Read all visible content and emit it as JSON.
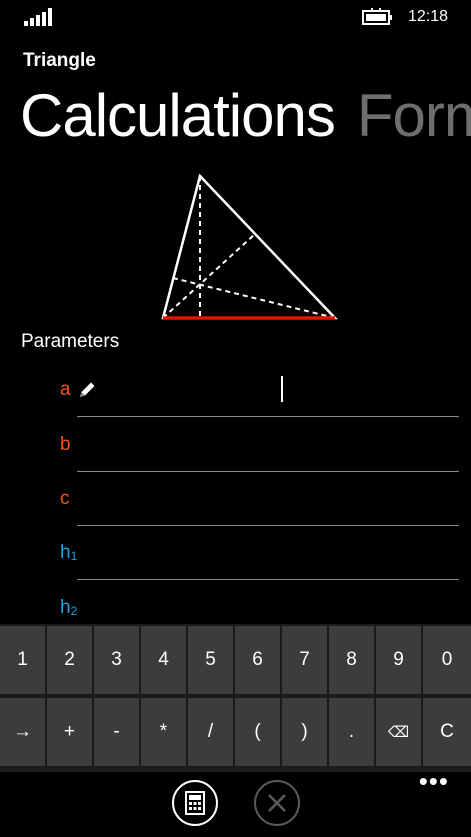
{
  "status": {
    "time": "12:18"
  },
  "app": {
    "title": "Triangle"
  },
  "pivot": {
    "active": "Calculations",
    "next": "Form"
  },
  "section": {
    "label": "Parameters"
  },
  "params": [
    {
      "label": "a",
      "sub": "",
      "color": "#f0541e",
      "value": ""
    },
    {
      "label": "b",
      "sub": "",
      "color": "#f0541e",
      "value": ""
    },
    {
      "label": "c",
      "sub": "",
      "color": "#f0541e",
      "value": ""
    },
    {
      "label": "h",
      "sub": "1",
      "color": "#1ba1e2",
      "value": ""
    },
    {
      "label": "h",
      "sub": "2",
      "color": "#1ba1e2",
      "value": ""
    }
  ],
  "keypad": {
    "row1": [
      "1",
      "2",
      "3",
      "4",
      "5",
      "6",
      "7",
      "8",
      "9",
      "0"
    ],
    "row2": [
      "→",
      "+",
      "-",
      "*",
      "/",
      "(",
      ")",
      ".",
      "⌫",
      "C"
    ]
  },
  "appbar": {
    "more": "•••"
  }
}
